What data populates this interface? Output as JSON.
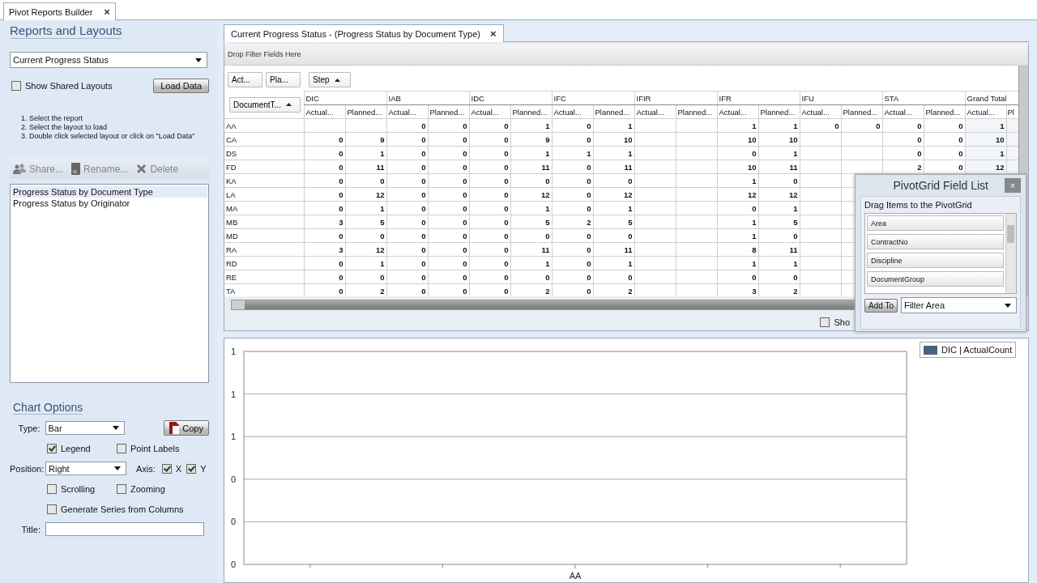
{
  "app_tab": {
    "label": "Pivot Reports Builder",
    "close": "×"
  },
  "left_panel": {
    "title": "Reports and Layouts",
    "report_select": {
      "value": "Current Progress Status"
    },
    "show_shared": {
      "label": "Show Shared Layouts",
      "checked": false
    },
    "load_button": "Load Data",
    "instructions": [
      "1. Select the report",
      "2. Select the layout to load",
      "3. Double click selected layout or click on \"Load Data\""
    ],
    "toolbar": [
      {
        "kind": "share",
        "label": "Share...",
        "disabled": true
      },
      {
        "kind": "rename",
        "label": "Rename...",
        "disabled": true
      },
      {
        "kind": "delete",
        "label": "Delete",
        "disabled": true
      }
    ],
    "layouts": [
      {
        "label": "Progress Status by Document Type",
        "selected": true
      },
      {
        "label": "Progress Status by Originator",
        "selected": false
      }
    ],
    "chart_options": {
      "title": "Chart Options",
      "type": {
        "label": "Type:",
        "value": "Bar"
      },
      "copy_button": "Copy",
      "legend": {
        "label": "Legend",
        "checked": true
      },
      "point_labels": {
        "label": "Point Labels",
        "checked": false
      },
      "position": {
        "label": "Position:",
        "value": "Right"
      },
      "axis": {
        "label": "Axis:",
        "x": {
          "label": "X",
          "checked": true
        },
        "y": {
          "label": "Y",
          "checked": true
        }
      },
      "scrolling": {
        "label": "Scrolling",
        "checked": false
      },
      "zooming": {
        "label": "Zooming",
        "checked": false
      },
      "generate_series": {
        "label": "Generate Series from Columns",
        "checked": false
      },
      "title_field": {
        "label": "Title:"
      }
    }
  },
  "document_tab": {
    "label": "Current Progress Status - (Progress Status by Document Type)",
    "close": "×"
  },
  "pivot": {
    "filter_area": "Drop Filter Fields Here",
    "data_fields": [
      {
        "label": "Act...",
        "sorted_ascending": false
      },
      {
        "label": "Pla...",
        "sorted_ascending": false
      },
      {
        "label": "Step",
        "sorted_ascending": true
      }
    ],
    "row_field": {
      "label": "DocumentT...",
      "sorted_ascending": true
    },
    "column_groups": [
      "DIC",
      "IAB",
      "IDC",
      "IFC",
      "IFIR",
      "IFR",
      "IFU",
      "STA",
      "Grand Total"
    ],
    "sub_headers": [
      "Actual...",
      "Planned...",
      "Actual...",
      "Planned...",
      "Actual...",
      "Planned...",
      "Actual...",
      "Planned...",
      "Actual...",
      "Planned...",
      "Actual...",
      "Planned...",
      "Actual...",
      "Planned...",
      "Actual...",
      "Planned...",
      "Actual...",
      "Pl"
    ],
    "rows": [
      {
        "label": "AA",
        "cells": [
          null,
          null,
          "0",
          "0",
          "0",
          "1",
          "0",
          "1",
          null,
          null,
          "1",
          "1",
          "0",
          "0",
          "0",
          "0",
          "1"
        ]
      },
      {
        "label": "CA",
        "cells": [
          "0",
          "9",
          "0",
          "0",
          "0",
          "9",
          "0",
          "10",
          null,
          null,
          "10",
          "10",
          null,
          null,
          "0",
          "0",
          "10"
        ]
      },
      {
        "label": "DS",
        "cells": [
          "0",
          "1",
          "0",
          "0",
          "0",
          "1",
          "1",
          "1",
          null,
          null,
          "0",
          "1",
          null,
          null,
          "0",
          "0",
          "1"
        ]
      },
      {
        "label": "FD",
        "cells": [
          "0",
          "11",
          "0",
          "0",
          "0",
          "11",
          "0",
          "11",
          null,
          null,
          "10",
          "11",
          null,
          null,
          "2",
          "0",
          "12"
        ]
      },
      {
        "label": "KA",
        "cells": [
          "0",
          "0",
          "0",
          "0",
          "0",
          "0",
          "0",
          "0",
          null,
          null,
          "1",
          "0"
        ]
      },
      {
        "label": "LA",
        "cells": [
          "0",
          "12",
          "0",
          "0",
          "0",
          "12",
          "0",
          "12",
          null,
          null,
          "12",
          "12"
        ]
      },
      {
        "label": "MA",
        "cells": [
          "0",
          "1",
          "0",
          "0",
          "0",
          "1",
          "0",
          "1",
          null,
          null,
          "0",
          "1"
        ]
      },
      {
        "label": "MB",
        "cells": [
          "3",
          "5",
          "0",
          "0",
          "0",
          "5",
          "2",
          "5",
          null,
          null,
          "1",
          "5"
        ]
      },
      {
        "label": "MD",
        "cells": [
          "0",
          "0",
          "0",
          "0",
          "0",
          "0",
          "0",
          "0",
          null,
          null,
          "1",
          "0"
        ]
      },
      {
        "label": "RA",
        "cells": [
          "3",
          "12",
          "0",
          "0",
          "0",
          "11",
          "0",
          "11",
          null,
          null,
          "8",
          "11"
        ]
      },
      {
        "label": "RD",
        "cells": [
          "0",
          "1",
          "0",
          "0",
          "0",
          "1",
          "0",
          "1",
          null,
          null,
          "1",
          "1"
        ]
      },
      {
        "label": "RE",
        "cells": [
          "0",
          "0",
          "0",
          "0",
          "0",
          "0",
          "0",
          "0",
          null,
          null,
          "0",
          "0"
        ]
      },
      {
        "label": "TA",
        "cells": [
          "0",
          "2",
          "0",
          "0",
          "0",
          "2",
          "0",
          "2",
          null,
          null,
          "3",
          "2"
        ]
      }
    ],
    "show_checkbox": {
      "label": "Sho",
      "checked": false
    },
    "field_list": {
      "title": "PivotGrid Field List",
      "close": "×",
      "hint": "Drag Items to the PivotGrid",
      "fields": [
        "Area",
        "ContractNo",
        "Discipline",
        "DocumentGroup"
      ],
      "add_button": "Add To",
      "target": {
        "value": "Filter Area"
      }
    }
  },
  "chart": {
    "chart_data": {
      "type": "bar",
      "grid": true,
      "categories": [
        "AA"
      ],
      "series": [
        {
          "name": "DIC | ActualCount",
          "color": "#4d6082",
          "values": [
            null
          ]
        }
      ],
      "ylim": [
        0,
        1
      ],
      "yticks": [
        {
          "value": 0,
          "label": "0"
        },
        {
          "value": 0.2,
          "label": "0"
        },
        {
          "value": 0.4,
          "label": "0"
        },
        {
          "value": 0.6,
          "label": "1"
        },
        {
          "value": 0.8,
          "label": "1"
        },
        {
          "value": 1,
          "label": "1"
        }
      ]
    }
  }
}
